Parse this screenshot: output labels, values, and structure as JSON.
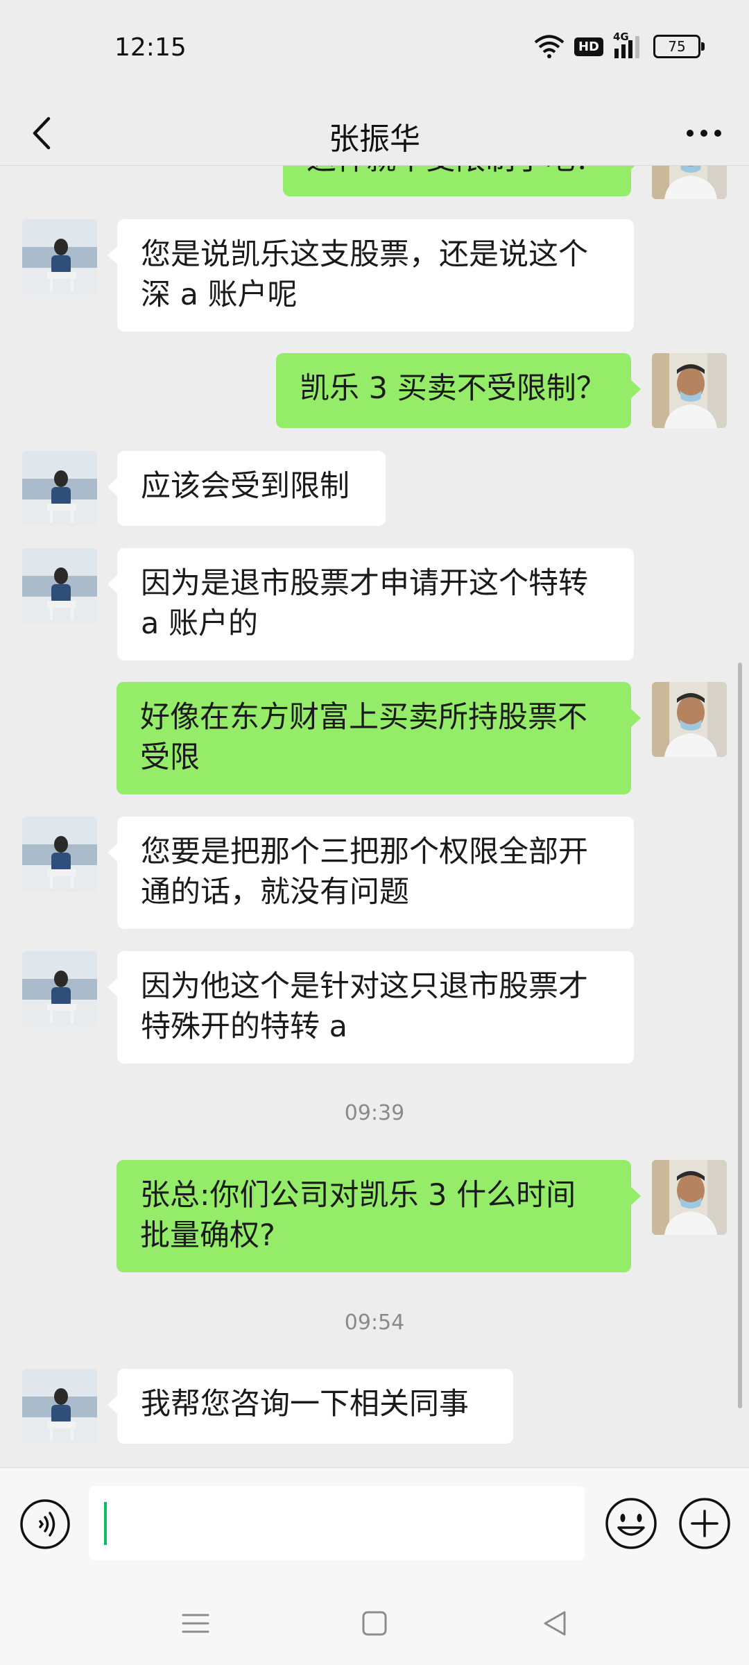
{
  "status_bar": {
    "time": "12:15",
    "hd": "HD",
    "network": "4G",
    "battery": "75"
  },
  "header": {
    "title": "张振华"
  },
  "messages": [
    {
      "side": "right",
      "text": "这样就不受限制了吧？"
    },
    {
      "side": "left",
      "line1": "您是说凯乐这支股票，还是说这个",
      "line2": "深 a 账户呢"
    },
    {
      "side": "right",
      "text": "凯乐 3 买卖不受限制？"
    },
    {
      "side": "left",
      "text": "应该会受到限制"
    },
    {
      "side": "left",
      "line1": "因为是退市股票才申请开这个特转",
      "line2": "a 账户的"
    },
    {
      "side": "right",
      "line1": "好像在东方财富上买卖所持股票不",
      "line2": "受限"
    },
    {
      "side": "left",
      "line1": "您要是把那个三把那个权限全部开",
      "line2": "通的话，就没有问题"
    },
    {
      "side": "left",
      "line1": "因为他这个是针对这只退市股票才",
      "line2": "特殊开的特转 a"
    },
    {
      "timestamp": "09:39"
    },
    {
      "side": "right",
      "line1": "张总:你们公司对凯乐 3 什么时间",
      "line2": "批量确权?"
    },
    {
      "timestamp": "09:54"
    },
    {
      "side": "left",
      "text": "我帮您咨询一下相关同事"
    }
  ],
  "input": {
    "value": ""
  },
  "colors": {
    "self_bubble": "#95ec69",
    "other_bubble": "#ffffff",
    "background": "#ededed",
    "caret": "#07c160"
  },
  "icons": {
    "back": "chevron-left-icon",
    "more": "more-dots-icon",
    "voice": "voice-icon",
    "emoji": "emoji-icon",
    "plus": "plus-icon",
    "nav_menu": "menu-icon",
    "nav_home": "home-square-icon",
    "nav_back": "back-triangle-icon"
  }
}
